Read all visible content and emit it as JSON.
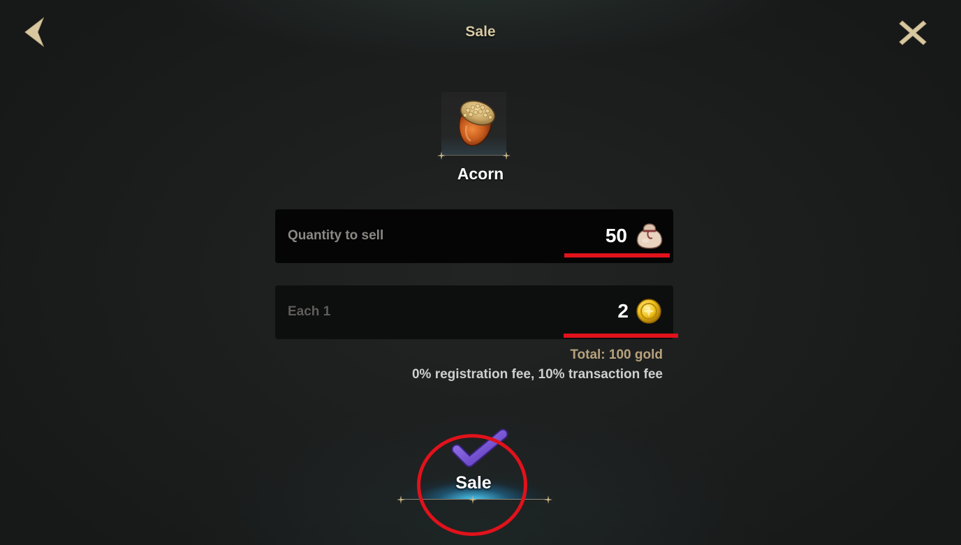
{
  "header": {
    "title": "Sale"
  },
  "item": {
    "name": "Acorn",
    "icon": "acorn-icon"
  },
  "quantity_row": {
    "label": "Quantity to sell",
    "value": "50",
    "icon": "bag-icon"
  },
  "price_row": {
    "label": "Each 1",
    "value": "2",
    "icon": "gold-coin-icon"
  },
  "summary": {
    "total": "Total: 100 gold",
    "fees": "0% registration fee, 10% transaction fee"
  },
  "sale_button": {
    "label": "Sale",
    "icon": "check-icon"
  },
  "colors": {
    "title": "#d9c9a3",
    "annotation_red": "#e0121b",
    "total_text": "#b7a27c",
    "button_glow": "#50d2ff",
    "check_purple": "#7b55d6"
  }
}
